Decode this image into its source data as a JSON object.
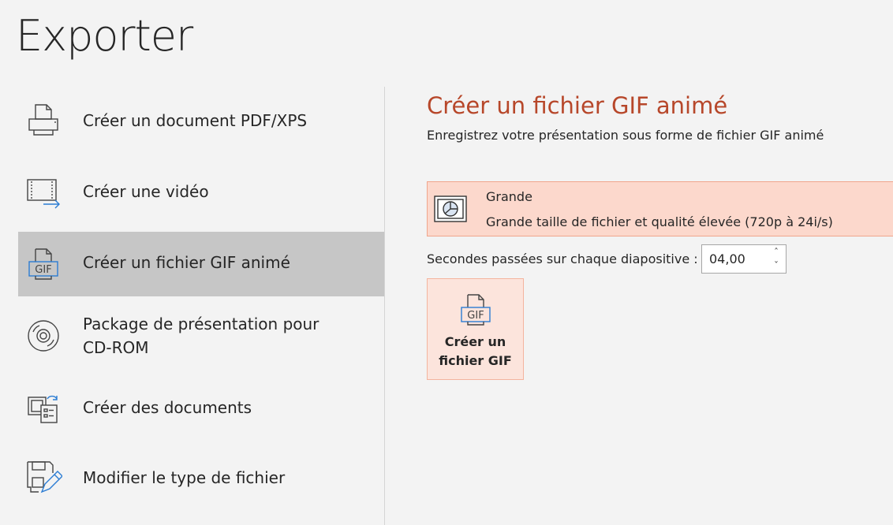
{
  "page": {
    "title": "Exporter"
  },
  "sidebar": {
    "items": [
      {
        "label": "Créer un document PDF/XPS",
        "icon": "pdf-document-icon"
      },
      {
        "label": "Créer une vidéo",
        "icon": "video-icon"
      },
      {
        "label": "Créer un fichier GIF animé",
        "icon": "gif-file-icon",
        "selected": true
      },
      {
        "label": "Package de présentation pour\nCD-ROM",
        "icon": "cd-rom-icon"
      },
      {
        "label": "Créer des documents",
        "icon": "handouts-icon"
      },
      {
        "label": "Modifier le type de fichier",
        "icon": "change-file-type-icon"
      }
    ]
  },
  "main": {
    "title": "Créer un fichier GIF animé",
    "description": "Enregistrez votre présentation sous forme de fichier GIF animé",
    "quality": {
      "name": "Grande",
      "detail": "Grande taille de fichier et qualité élevée (720p à 24i/s)",
      "icon": "slide-quality-icon"
    },
    "seconds": {
      "label": "Secondes passées sur chaque diapositive :",
      "value": "04,00"
    },
    "create_button": {
      "label": "Créer un\nfichier GIF",
      "icon": "gif-file-icon"
    }
  },
  "colors": {
    "accent": "#b7472a",
    "selected_bg": "#c6c6c6",
    "quality_bg": "#fcd8cc",
    "button_bg": "#fce4dc"
  }
}
